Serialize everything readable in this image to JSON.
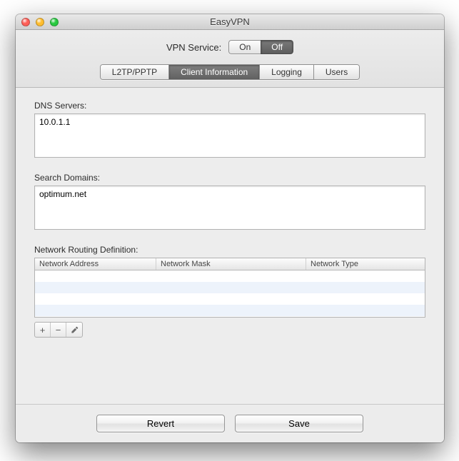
{
  "window": {
    "title": "EasyVPN"
  },
  "service": {
    "label": "VPN Service:",
    "on_label": "On",
    "off_label": "Off",
    "state": "off"
  },
  "tabs": {
    "l2tp": "L2TP/PPTP",
    "client": "Client Information",
    "logging": "Logging",
    "users": "Users",
    "active": "client"
  },
  "dns": {
    "label": "DNS Servers:",
    "value": "10.0.1.1"
  },
  "search": {
    "label": "Search Domains:",
    "value": "optimum.net"
  },
  "routing": {
    "label": "Network Routing Definition:",
    "columns": {
      "addr": "Network Address",
      "mask": "Network Mask",
      "type": "Network Type"
    },
    "rows": []
  },
  "toolbar": {
    "add": "+",
    "remove": "−",
    "edit": "edit"
  },
  "footer": {
    "revert": "Revert",
    "save": "Save"
  }
}
